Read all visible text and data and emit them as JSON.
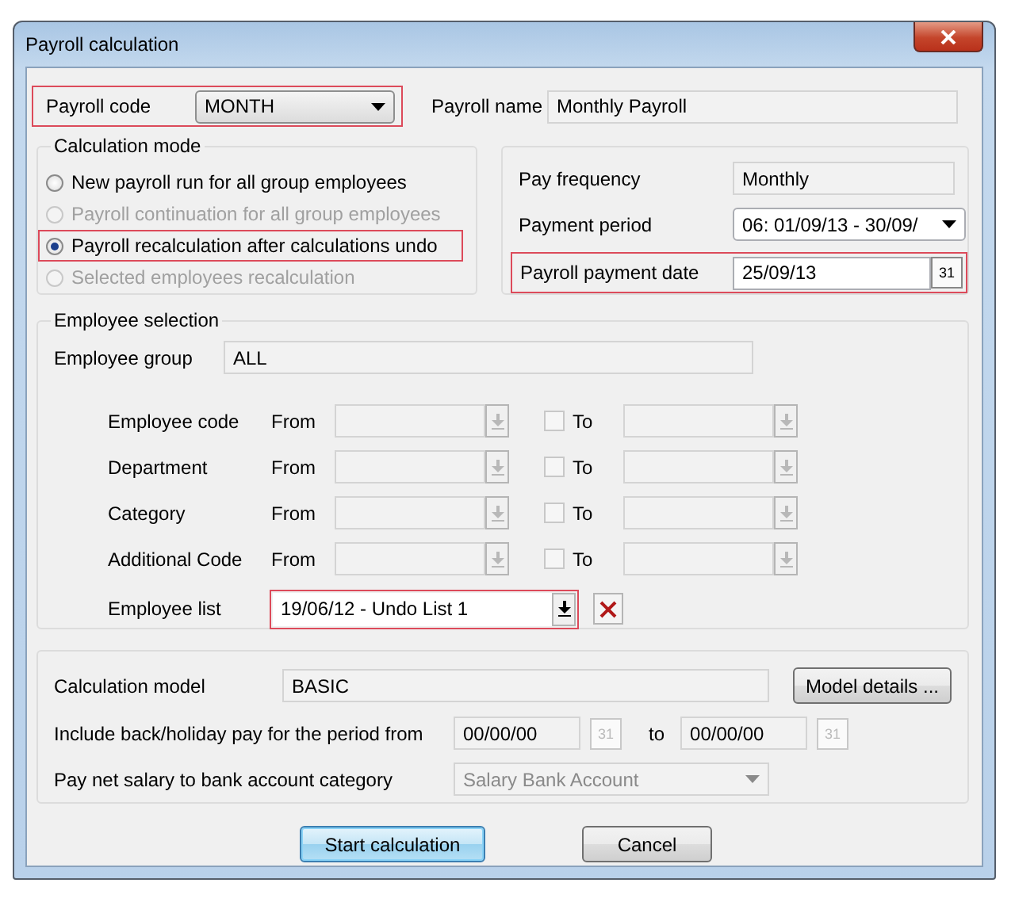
{
  "window": {
    "title": "Payroll calculation"
  },
  "payroll_code": {
    "label": "Payroll code",
    "value": "MONTH",
    "highlighted": true
  },
  "payroll_name": {
    "label": "Payroll name",
    "value": "Monthly Payroll"
  },
  "calculation_mode": {
    "title": "Calculation mode",
    "options": [
      {
        "label": "New payroll run for all group employees",
        "selected": false,
        "disabled": false,
        "highlighted": false
      },
      {
        "label": "Payroll continuation for all group employees",
        "selected": false,
        "disabled": true,
        "highlighted": false
      },
      {
        "label": "Payroll recalculation after calculations undo",
        "selected": true,
        "disabled": false,
        "highlighted": true
      },
      {
        "label": "Selected employees recalculation",
        "selected": false,
        "disabled": true,
        "highlighted": false
      }
    ]
  },
  "pay_frequency": {
    "label": "Pay frequency",
    "value": "Monthly"
  },
  "payment_period": {
    "label": "Payment period",
    "value": "06: 01/09/13 - 30/09/"
  },
  "payment_date": {
    "label": "Payroll payment date",
    "value": "25/09/13",
    "calendar": "31",
    "highlighted": true
  },
  "employee_selection": {
    "title": "Employee selection",
    "group_label": "Employee group",
    "group_value": "ALL",
    "rows": [
      {
        "label": "Employee code",
        "from_label": "From",
        "to_label": "To",
        "checked": false,
        "disabled": true
      },
      {
        "label": "Department",
        "from_label": "From",
        "to_label": "To",
        "checked": false,
        "disabled": true
      },
      {
        "label": "Category",
        "from_label": "From",
        "to_label": "To",
        "checked": false,
        "disabled": true
      },
      {
        "label": "Additional Code",
        "from_label": "From",
        "to_label": "To",
        "checked": false,
        "disabled": true
      }
    ],
    "list": {
      "label": "Employee list",
      "value": "19/06/12 - Undo List 1",
      "highlighted": true
    }
  },
  "calculation_model": {
    "label": "Calculation model",
    "value": "BASIC",
    "button": "Model details ..."
  },
  "back_pay": {
    "label": "Include back/holiday pay for the period from",
    "from": "00/00/00",
    "from_calendar": "31",
    "to_label": "to",
    "to": "00/00/00",
    "to_calendar": "31",
    "disabled": true
  },
  "bank_account": {
    "label": "Pay net salary to bank account category",
    "value": "Salary Bank Account",
    "disabled": true
  },
  "buttons": [
    {
      "label": "Start calculation",
      "focused": true
    },
    {
      "label": "Cancel",
      "focused": false
    }
  ]
}
